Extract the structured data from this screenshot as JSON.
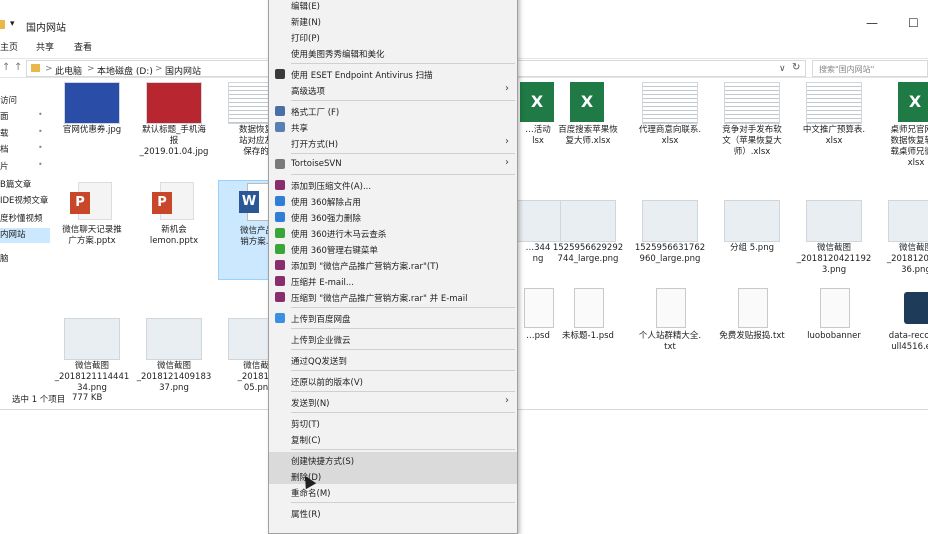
{
  "window": {
    "title": "国内网站",
    "quick_access_arrow": "▾",
    "controls": {
      "minimize": "—",
      "maximize": "☐"
    },
    "ribbon_tabs": [
      "主页",
      "共享",
      "查看"
    ],
    "nav": {
      "back": "←",
      "forward": "→",
      "up": "↑"
    },
    "breadcrumbs": [
      "此电脑",
      "本地磁盘 (D:)",
      "国内网站"
    ],
    "crumb_sep": ">",
    "refresh": "↻",
    "dropdown": "∨",
    "search_placeholder": "搜索\"国内网站\""
  },
  "navpane": {
    "items": [
      {
        "label": "访问",
        "pinned": false
      },
      {
        "label": "面",
        "pinned": true
      },
      {
        "label": "载",
        "pinned": true
      },
      {
        "label": "档",
        "pinned": true
      },
      {
        "label": "片",
        "pinned": true
      },
      {
        "label": "B篇文章",
        "pinned": false
      },
      {
        "label": "IDE视频文章",
        "pinned": false
      },
      {
        "label": "度秒懂视频",
        "pinned": false
      },
      {
        "label": "内网站",
        "pinned": false,
        "selected": true
      },
      {
        "label": "脑",
        "pinned": false
      }
    ],
    "pin_glyph": "📌"
  },
  "files": [
    {
      "name": "官网优惠券.jpg",
      "kind": "img-blue"
    },
    {
      "name": "默认标题_手机海\n报\n_2019.01.04.jpg",
      "kind": "img-red"
    },
    {
      "name": "数据恢复\n站对应友\n保存的",
      "kind": "img-sheet"
    },
    {
      "name": "微信聊天记录推\n广方案.pptx",
      "kind": "ppt"
    },
    {
      "name": "新机会\nlemon.pptx",
      "kind": "ppt"
    },
    {
      "name": "微信产品\n销方案.d",
      "kind": "word",
      "selected": true
    },
    {
      "name": "微信截图\n_2018121114441\n34.png",
      "kind": "img"
    },
    {
      "name": "微信截图\n_2018121409183\n37.png",
      "kind": "img"
    },
    {
      "name": "微信截\n_201812\n05.pn",
      "kind": "img"
    },
    {
      "name": "…活动\nlsx",
      "kind": "xls"
    },
    {
      "name": "百度搜索苹果恢\n复大师.xlsx",
      "kind": "xls"
    },
    {
      "name": "代理商意向联系.\nxlsx",
      "kind": "img-sheet"
    },
    {
      "name": "竞争对手发布软\n文（苹果恢复大\n师）.xlsx",
      "kind": "img-sheet"
    },
    {
      "name": "中文推广预算表.\nxlsx",
      "kind": "img-sheet"
    },
    {
      "name": "桌师兄官网安\n数据恢复软件\n载桌师兄微信\nxlsx",
      "kind": "xls"
    },
    {
      "name": "…344\nng",
      "kind": "img"
    },
    {
      "name": "1525956629292\n744_large.png",
      "kind": "img"
    },
    {
      "name": "1525956631762\n960_large.png",
      "kind": "img"
    },
    {
      "name": "分组 5.png",
      "kind": "img"
    },
    {
      "name": "微信截图\n_2018120421192\n3.png",
      "kind": "img"
    },
    {
      "name": "微信截图\n_2018120421\n36.png",
      "kind": "img"
    },
    {
      "name": "…psd",
      "kind": "doc"
    },
    {
      "name": "未标题-1.psd",
      "kind": "doc"
    },
    {
      "name": "个人站群精大全.\ntxt",
      "kind": "doc"
    },
    {
      "name": "免费发贴报捣.txt",
      "kind": "doc"
    },
    {
      "name": "luobobanner",
      "kind": "doc"
    },
    {
      "name": "data-recover\null4516.exe",
      "kind": "exe"
    }
  ],
  "file_badges": {
    "ppt": "P",
    "word": "W",
    "xls": "X"
  },
  "status": {
    "selection": "选中 1 个项目",
    "size": "777 KB"
  },
  "context_menu": {
    "items": [
      {
        "label": "编辑(E)"
      },
      {
        "label": "新建(N)"
      },
      {
        "label": "打印(P)"
      },
      {
        "label": "使用美图秀秀编辑和美化"
      },
      {
        "sep": true
      },
      {
        "label": "使用 ESET Endpoint Antivirus 扫描",
        "icon": "#3a3a3a"
      },
      {
        "label": "高级选项",
        "arrow": true
      },
      {
        "sep": true
      },
      {
        "label": "格式工厂 (F)",
        "icon": "#4a6fa5"
      },
      {
        "label": "共享",
        "icon": "#5a7fb5"
      },
      {
        "label": "打开方式(H)",
        "arrow": true
      },
      {
        "sep": true
      },
      {
        "label": "TortoiseSVN",
        "icon": "#7a7a7a",
        "arrow": true
      },
      {
        "sep": true
      },
      {
        "label": "添加到压缩文件(A)...",
        "icon": "#8b2d6b"
      },
      {
        "label": "使用 360解除占用",
        "icon": "#2f7fd9"
      },
      {
        "label": "使用 360强力删除",
        "icon": "#2f7fd9"
      },
      {
        "label": "使用 360进行木马云查杀",
        "icon": "#3aa63a"
      },
      {
        "label": "使用 360管理右键菜单",
        "icon": "#3aa63a"
      },
      {
        "label": "添加到 \"微信产品推广营销方案.rar\"(T)",
        "icon": "#8b2d6b"
      },
      {
        "label": "压缩并 E-mail...",
        "icon": "#8b2d6b"
      },
      {
        "label": "压缩到 \"微信产品推广营销方案.rar\" 并 E-mail",
        "icon": "#8b2d6b"
      },
      {
        "sep": true
      },
      {
        "label": "上传到百度网盘",
        "icon": "#3a8fe0"
      },
      {
        "sep": true
      },
      {
        "label": "上传到企业微云"
      },
      {
        "sep": true
      },
      {
        "label": "通过QQ发送到"
      },
      {
        "sep": true
      },
      {
        "label": "还原以前的版本(V)"
      },
      {
        "sep": true
      },
      {
        "label": "发送到(N)",
        "arrow": true
      },
      {
        "sep": true
      },
      {
        "label": "剪切(T)"
      },
      {
        "label": "复制(C)"
      },
      {
        "sep": true
      },
      {
        "label": "创建快捷方式(S)",
        "hover": true
      },
      {
        "label": "删除(D)",
        "hover": true
      },
      {
        "label": "重命名(M)"
      },
      {
        "sep": true
      },
      {
        "label": "属性(R)"
      }
    ],
    "arrow_glyph": "›"
  }
}
